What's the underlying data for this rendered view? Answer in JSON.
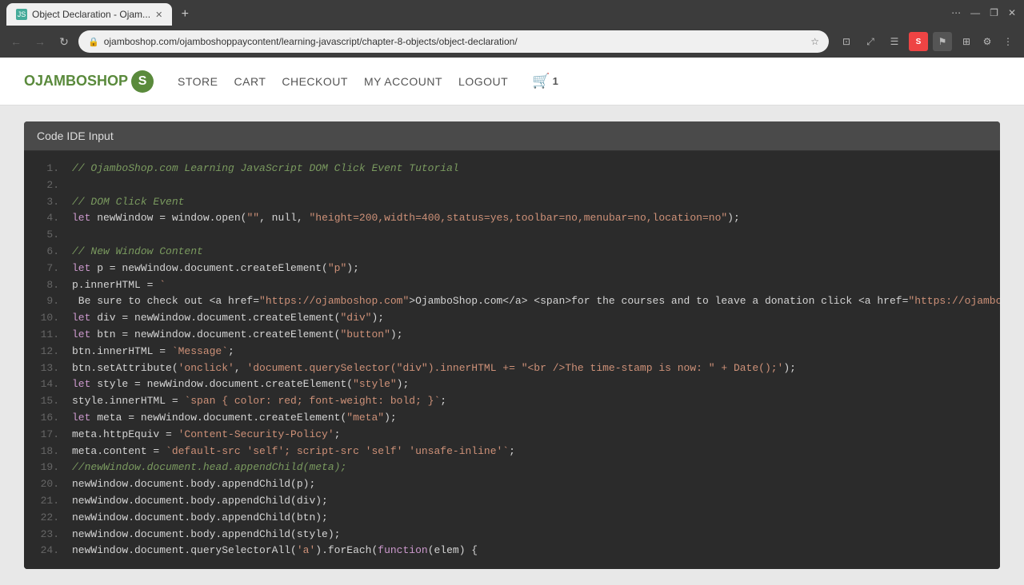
{
  "browser": {
    "tab_title": "Object Declaration - Ojam...",
    "tab_favicon": "JS",
    "url": "ojamboshop.com/ojamboshoppaycontent/learning-javascript/chapter-8-objects/object-declaration/",
    "new_tab_label": "+",
    "nav": {
      "back_disabled": true,
      "forward_disabled": true
    }
  },
  "site": {
    "logo_text": "OJAMBOSHOP",
    "logo_letter": "S",
    "nav_links": [
      {
        "label": "STORE",
        "id": "store"
      },
      {
        "label": "CART",
        "id": "cart"
      },
      {
        "label": "CHECKOUT",
        "id": "checkout"
      },
      {
        "label": "MY ACCOUNT",
        "id": "my-account"
      },
      {
        "label": "LOGOUT",
        "id": "logout"
      }
    ],
    "cart_count": "1"
  },
  "code_ide": {
    "header": "Code IDE Input",
    "lines": [
      {
        "num": "1.",
        "content": "comment_tutorial"
      },
      {
        "num": "2.",
        "content": "empty"
      },
      {
        "num": "3.",
        "content": "comment_dom"
      },
      {
        "num": "4.",
        "content": "let_newwindow"
      },
      {
        "num": "5.",
        "content": "empty"
      },
      {
        "num": "6.",
        "content": "comment_newwindow_content"
      },
      {
        "num": "7.",
        "content": "let_p"
      },
      {
        "num": "8.",
        "content": "p_innerhtml"
      },
      {
        "num": "9.",
        "content": "be_sure"
      },
      {
        "num": "10.",
        "content": "let_div"
      },
      {
        "num": "11.",
        "content": "let_btn"
      },
      {
        "num": "12.",
        "content": "btn_innerhtml"
      },
      {
        "num": "13.",
        "content": "btn_setattr"
      },
      {
        "num": "14.",
        "content": "let_style"
      },
      {
        "num": "15.",
        "content": "style_innerhtml"
      },
      {
        "num": "16.",
        "content": "let_meta"
      },
      {
        "num": "17.",
        "content": "meta_httpequiv"
      },
      {
        "num": "18.",
        "content": "meta_content"
      },
      {
        "num": "19.",
        "content": "comment_appendchild_meta"
      },
      {
        "num": "20.",
        "content": "appendchild_p"
      },
      {
        "num": "21.",
        "content": "appendchild_div"
      },
      {
        "num": "22.",
        "content": "appendchild_btn"
      },
      {
        "num": "23.",
        "content": "appendchild_style"
      },
      {
        "num": "24.",
        "content": "queryselectorall"
      }
    ]
  }
}
